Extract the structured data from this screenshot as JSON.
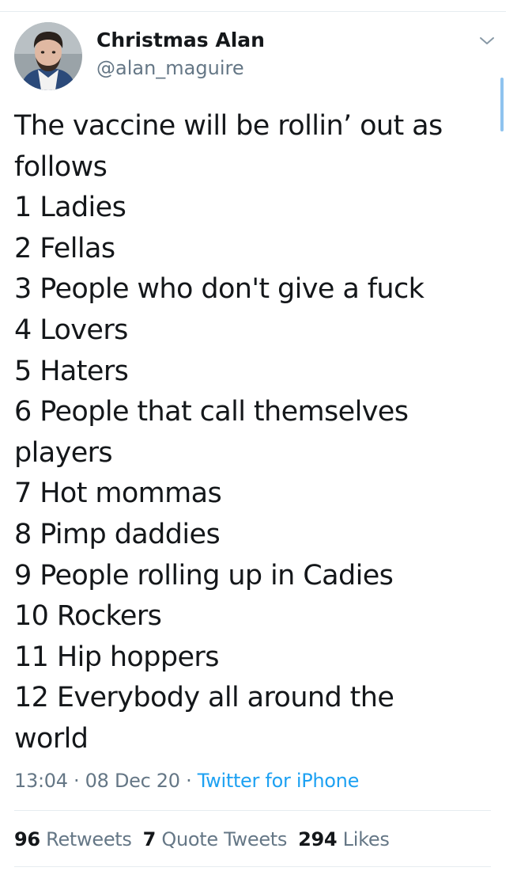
{
  "author": {
    "display_name": "Christmas Alan",
    "handle": "@alan_maguire"
  },
  "tweet": {
    "lines": [
      "The vaccine will be rollin’ out as",
      "follows",
      "1 Ladies",
      "2 Fellas",
      "3 People who don't give a fuck",
      "4 Lovers",
      "5 Haters",
      "6 People that call themselves",
      "players",
      "7 Hot mommas",
      "8 Pimp daddies",
      "9 People rolling up in Cadies",
      "10 Rockers",
      "11 Hip hoppers",
      "12 Everybody all around the",
      "world"
    ]
  },
  "meta": {
    "time": "13:04",
    "separator": " · ",
    "date": "08 Dec 20",
    "source": "Twitter for iPhone"
  },
  "stats": {
    "retweets_count": "96",
    "retweets_label": "Retweets",
    "quotes_count": "7",
    "quotes_label": "Quote Tweets",
    "likes_count": "294",
    "likes_label": "Likes"
  },
  "icons": {
    "caret": "chevron-down-icon",
    "avatar": "avatar"
  },
  "colors": {
    "text": "#14171a",
    "secondary": "#657786",
    "link": "#1da1f2",
    "divider": "#e6ecf0"
  }
}
